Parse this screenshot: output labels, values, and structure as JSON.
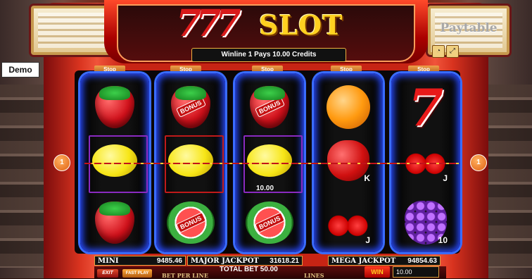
{
  "demo_badge": "Demo",
  "logo": {
    "numerals": "777",
    "word": "SLOT"
  },
  "paytable_label": "Paytable",
  "win_message": "Winline 1 Pays 10.00 Credits",
  "stop_label": "Stop",
  "reels": [
    [
      {
        "symbol": "strawberry-icon"
      },
      {
        "symbol": "lemon-icon"
      },
      {
        "symbol": "strawberry-icon"
      }
    ],
    [
      {
        "symbol": "strawberry-icon",
        "tag": "BONUS"
      },
      {
        "symbol": "lemon-icon"
      },
      {
        "symbol": "watermelon-icon",
        "tag": "BONUS"
      }
    ],
    [
      {
        "symbol": "strawberry-icon",
        "tag": "BONUS"
      },
      {
        "symbol": "lemon-icon"
      },
      {
        "symbol": "watermelon-icon",
        "tag": "BONUS"
      }
    ],
    [
      {
        "symbol": "orange-icon"
      },
      {
        "symbol": "apple-icon",
        "letter": "K"
      },
      {
        "symbol": "cherry-icon",
        "letter": "J"
      }
    ],
    [
      {
        "symbol": "seven-icon",
        "glyph": "7"
      },
      {
        "symbol": "cherry-icon",
        "letter": "J"
      },
      {
        "symbol": "grape-icon",
        "letter": "10"
      }
    ]
  ],
  "win_amount": "10.00",
  "winline_number": "1",
  "jackpots": {
    "mini": {
      "label": "MINI JACKPOT",
      "value": "9485.46"
    },
    "major": {
      "label": "MAJOR JACKPOT",
      "value": "31618.21"
    },
    "mega": {
      "label": "MEGA JACKPOT",
      "value": "94854.63"
    }
  },
  "controls": {
    "exit": "EXIT",
    "fast_play": "FAST PLAY",
    "bet_per_line": "BET PER LINE",
    "total_bet_label": "TOTAL BET",
    "total_bet_value": "50.00",
    "lines": "LINES",
    "win": "WIN",
    "win_value": "10.00"
  },
  "colors": {
    "cabinet_red": "#c72414",
    "reel_glow": "#3a6cff",
    "winline": "#c1121a",
    "gold": "#ffd020"
  }
}
